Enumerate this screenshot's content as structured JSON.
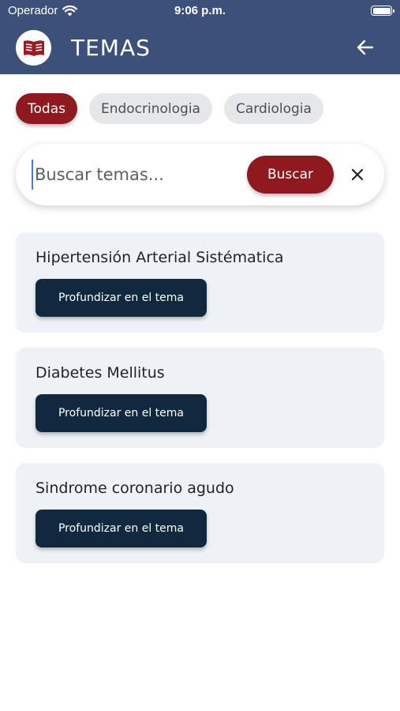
{
  "status_bar": {
    "carrier": "Operador",
    "time": "9:06 p.m."
  },
  "header": {
    "title": "TEMAS",
    "logo_icon": "book-icon",
    "back_icon": "arrow-left-icon",
    "background_color": "#3d5079"
  },
  "filters": [
    {
      "label": "Todas",
      "active": true
    },
    {
      "label": "Endocrinologia",
      "active": false
    },
    {
      "label": "Cardiologia",
      "active": false
    }
  ],
  "search": {
    "placeholder": "Buscar temas...",
    "value": "",
    "button_label": "Buscar",
    "clear_icon": "close-icon"
  },
  "topics": [
    {
      "title": "Hipertensión Arterial Sistématica",
      "button_label": "Profundizar en el tema"
    },
    {
      "title": "Diabetes Mellitus",
      "button_label": "Profundizar en el tema"
    },
    {
      "title": "Sindrome coronario agudo",
      "button_label": "Profundizar en el tema"
    }
  ],
  "colors": {
    "accent": "#8e1a20",
    "topic_button": "#10293f",
    "card_background": "#eef1f5"
  }
}
